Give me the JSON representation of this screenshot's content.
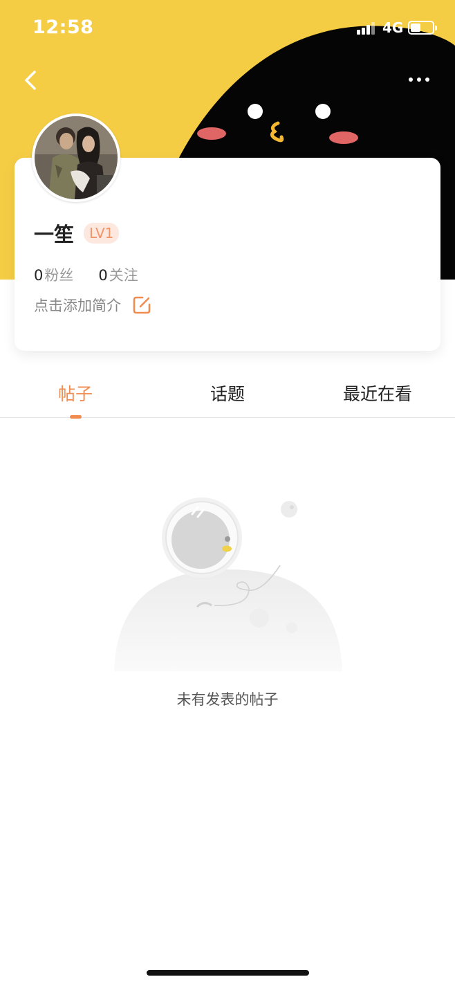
{
  "status_bar": {
    "time": "12:58",
    "network": "4G",
    "battery_level": 0.45
  },
  "header": {
    "back_icon": "chevron-left-icon",
    "more_icon": "more-horizontal-icon",
    "banner_color": "#f5cd45"
  },
  "profile": {
    "name": "一笙",
    "level": "LV1",
    "fans_count": "0",
    "fans_label": "粉丝",
    "following_count": "0",
    "following_label": "关注",
    "bio_placeholder": "点击添加简介",
    "edit_icon": "edit-icon"
  },
  "tabs": [
    {
      "label": "帖子",
      "active": true
    },
    {
      "label": "话题",
      "active": false
    },
    {
      "label": "最近在看",
      "active": false
    }
  ],
  "empty_state": {
    "message": "未有发表的帖子",
    "illustration": "astronaut-on-planet-illustration"
  },
  "colors": {
    "accent": "#f08c50",
    "level_badge_bg": "#fde8e0"
  }
}
